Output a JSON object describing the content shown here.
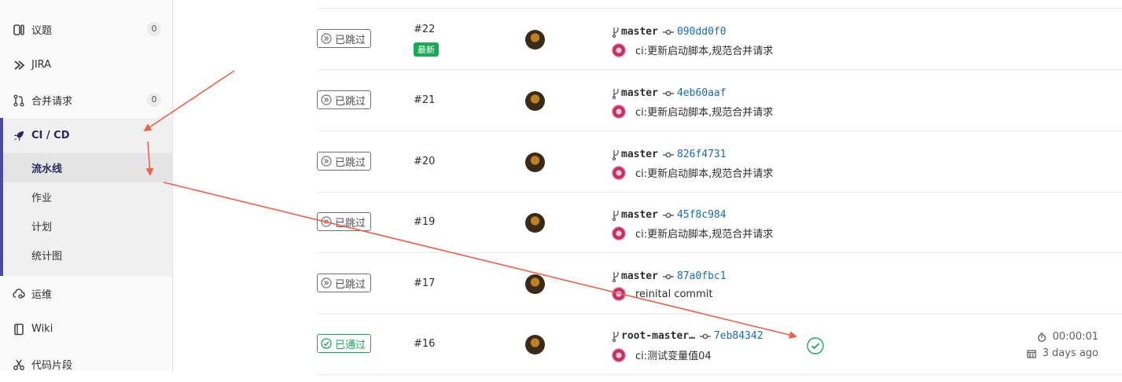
{
  "sidebar": {
    "issues": {
      "label": "议题",
      "count": "0"
    },
    "jira": {
      "label": "JIRA"
    },
    "merge_requests": {
      "label": "合并请求",
      "count": "0"
    },
    "cicd": {
      "label": "CI / CD",
      "items": [
        {
          "label": "流水线",
          "active": true
        },
        {
          "label": "作业"
        },
        {
          "label": "计划"
        },
        {
          "label": "统计图"
        }
      ]
    },
    "operations": {
      "label": "运维"
    },
    "wiki": {
      "label": "Wiki"
    },
    "snippets": {
      "label": "代码片段"
    }
  },
  "pipelines": [
    {
      "status": "已跳过",
      "id": "#22",
      "latest_badge": "最新",
      "branch": "master",
      "sha": "090dd0f0",
      "message": "ci:更新启动脚本,规范合并请求"
    },
    {
      "status": "已跳过",
      "id": "#21",
      "branch": "master",
      "sha": "4eb60aaf",
      "message": "ci:更新启动脚本,规范合并请求"
    },
    {
      "status": "已跳过",
      "id": "#20",
      "branch": "master",
      "sha": "826f4731",
      "message": "ci:更新启动脚本,规范合并请求"
    },
    {
      "status": "已跳过",
      "id": "#19",
      "branch": "master",
      "sha": "45f8c984",
      "message": "ci:更新启动脚本,规范合并请求"
    },
    {
      "status": "已跳过",
      "id": "#17",
      "branch": "master",
      "sha": "87a0fbc1",
      "message": "reinital commit"
    },
    {
      "status": "已通过",
      "id": "#16",
      "branch": "root-master…",
      "sha": "7eb84342",
      "message": "ci:测试变量值04",
      "duration": "00:00:01",
      "finished": "3 days ago"
    }
  ],
  "colors": {
    "accent": "#4b4ba3",
    "passed": "#1aaa55",
    "link": "#1b69b6",
    "annotation": "#f0604a"
  }
}
